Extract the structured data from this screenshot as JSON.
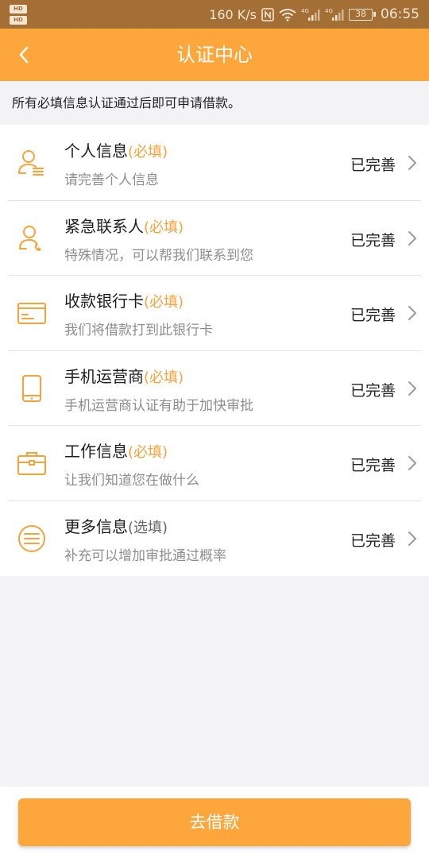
{
  "status_bar": {
    "hd_badge_1": "HD",
    "hd_badge_2": "HD",
    "network_speed": "160 K/s",
    "network_1": "4G",
    "network_2": "4G",
    "battery": "38",
    "time": "06:55"
  },
  "header": {
    "title": "认证中心",
    "back_icon": "chevron-left-icon"
  },
  "notice": "所有必填信息认证通过后即可申请借款。",
  "items": [
    {
      "icon": "user-info-icon",
      "title": "个人信息",
      "tag": "(必填)",
      "subtitle": "请完善个人信息",
      "status": "已完善"
    },
    {
      "icon": "contact-phone-icon",
      "title": "紧急联系人",
      "tag": "(必填)",
      "subtitle": "特殊情况，可以帮我们联系到您",
      "status": "已完善"
    },
    {
      "icon": "bank-card-icon",
      "title": "收款银行卡",
      "tag": "(必填)",
      "subtitle": "我们将借款打到此银行卡",
      "status": "已完善"
    },
    {
      "icon": "mobile-phone-icon",
      "title": "手机运营商",
      "tag": "(必填)",
      "subtitle": "手机运营商认证有助于加快审批",
      "status": "已完善"
    },
    {
      "icon": "briefcase-icon",
      "title": "工作信息",
      "tag": "(必填)",
      "subtitle": "让我们知道您在做什么",
      "status": "已完善"
    },
    {
      "icon": "menu-circle-icon",
      "title": "更多信息",
      "tag": "(选填)",
      "subtitle": "补充可以增加审批通过概率",
      "status": "已完善"
    }
  ],
  "colors": {
    "accent": "#fca63b",
    "status_bar": "#a46f35",
    "required_tag": "#f7a23a"
  },
  "bottom_button": "去借款"
}
